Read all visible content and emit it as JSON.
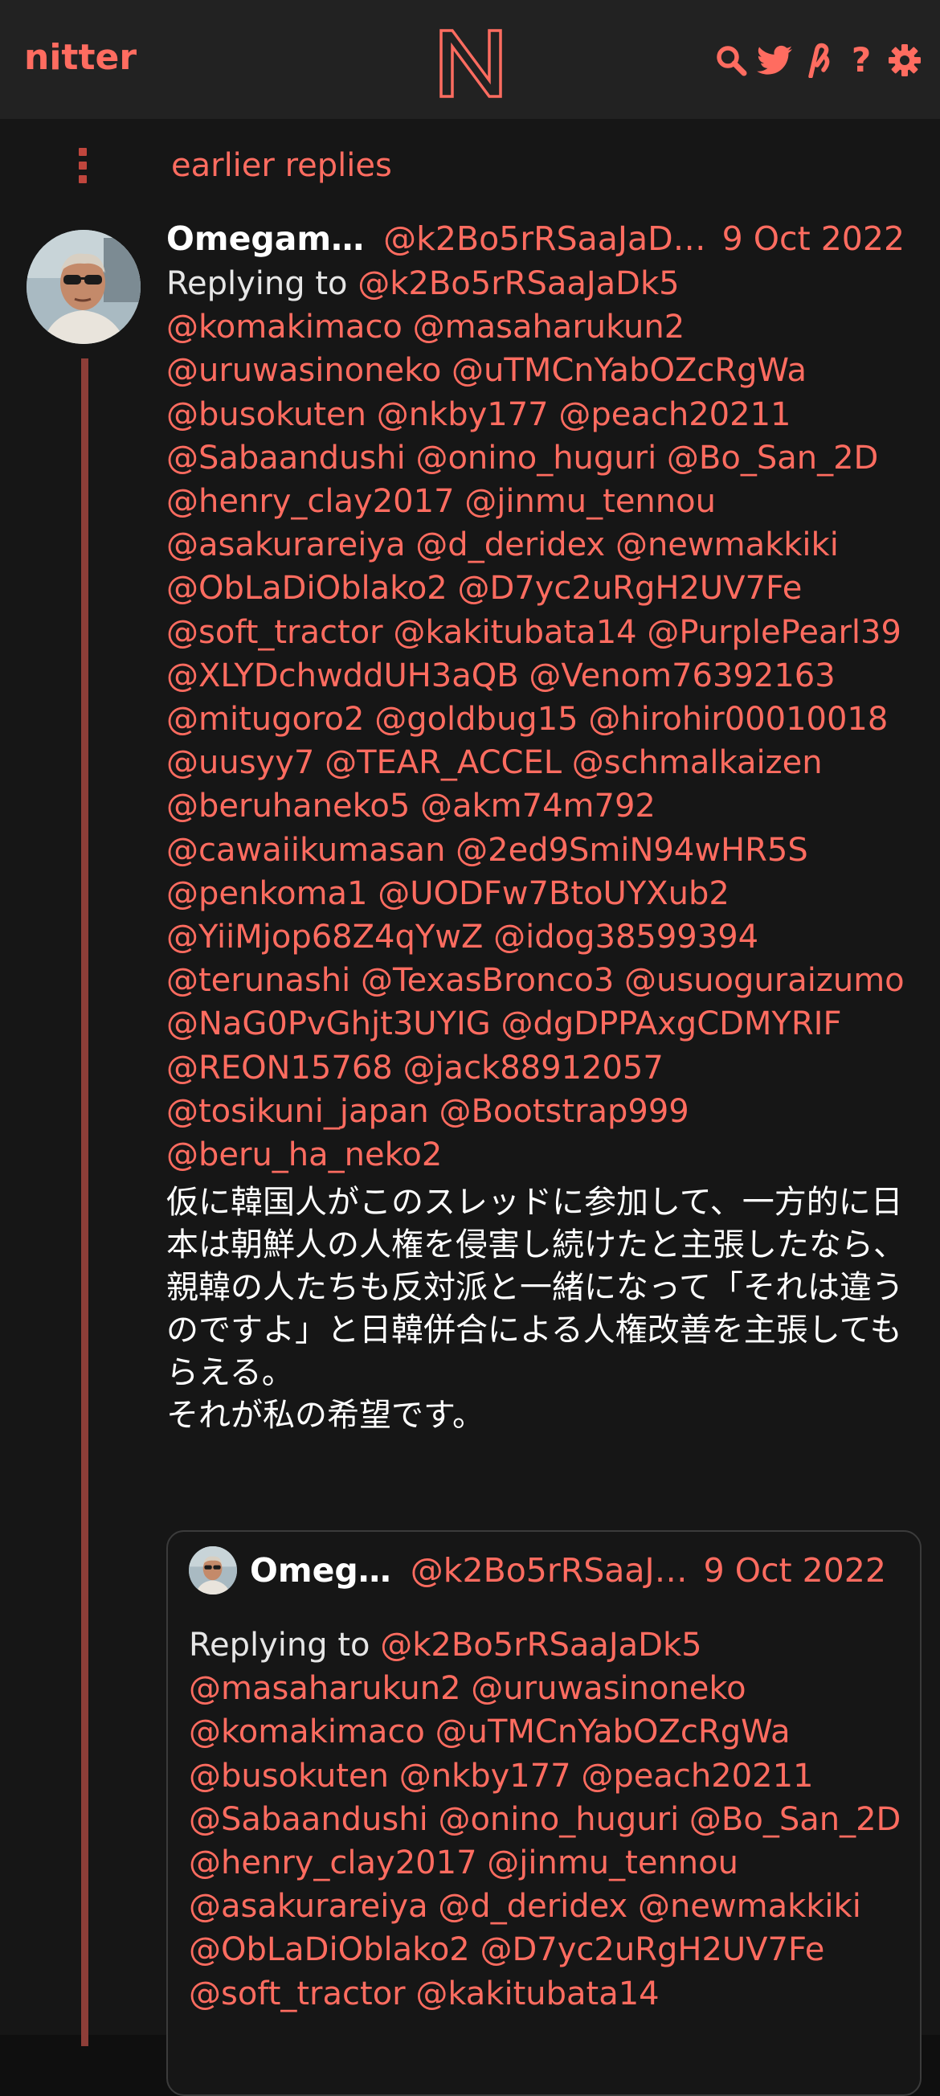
{
  "navbar": {
    "brand": "nitter",
    "logo_letter": "N",
    "icons": [
      "search-icon",
      "twitter-bird-icon",
      "rss-icon",
      "help-icon",
      "settings-gear-icon"
    ],
    "help_glyph": "?"
  },
  "colors": {
    "accent": "#ff6c60",
    "background": "#161616",
    "navbar_bg": "#222222",
    "thread_line": "#8e3e38"
  },
  "thread": {
    "earlier_replies": "earlier replies"
  },
  "tweet": {
    "fullname": "Omegam…",
    "username": "@k2Bo5rRSaaJaD…",
    "date": "9 Oct 2022",
    "replying_label": "Replying to",
    "mentions": [
      "@k2Bo5rRSaaJaDk5",
      "@komakimaco",
      "@masaharukun2",
      "@uruwasinoneko",
      "@uTMCnYabOZcRgWa",
      "@busokuten",
      "@nkby177",
      "@peach20211",
      "@Sabaandushi",
      "@onino_huguri",
      "@Bo_San_2D",
      "@henry_clay2017",
      "@jinmu_tennou",
      "@asakurareiya",
      "@d_deridex",
      "@newmakkiki",
      "@ObLaDiOblako2",
      "@D7yc2uRgH2UV7Fe",
      "@soft_tractor",
      "@kakitubata14",
      "@PurplePearl39",
      "@XLYDchwddUH3aQB",
      "@Venom76392163",
      "@mitugoro2",
      "@goldbug15",
      "@hirohir00010018",
      "@uusyy7",
      "@TEAR_ACCEL",
      "@schmalkaizen",
      "@beruhaneko5",
      "@akm74m792",
      "@cawaiikumasan",
      "@2ed9SmiN94wHR5S",
      "@penkoma1",
      "@UODFw7BtoUYXub2",
      "@YiiMjop68Z4qYwZ",
      "@idog38599394",
      "@terunashi",
      "@TexasBronco3",
      "@usuoguraizumo",
      "@NaG0PvGhjt3UYIG",
      "@dgDPPAxgCDMYRIF",
      "@REON15768",
      "@jack88912057",
      "@tosikuni_japan",
      "@Bootstrap999",
      "@beru_ha_neko2"
    ],
    "content": "仮に韓国人がこのスレッドに参加して、一方的に日本は朝鮮人の人権を侵害し続けたと主張したなら、親韓の人たちも反対派と一緒になって「それは違うのですよ」と日韓併合による人権改善を主張してもらえる。\nそれが私の希望です。"
  },
  "quote": {
    "fullname": "Omeg…",
    "username": "@k2Bo5rRSaaJ…",
    "date": "9 Oct 2022",
    "replying_label": "Replying to",
    "mentions": [
      "@k2Bo5rRSaaJaDk5",
      "@masaharukun2",
      "@uruwasinoneko",
      "@komakimaco",
      "@uTMCnYabOZcRgWa",
      "@busokuten",
      "@nkby177",
      "@peach20211",
      "@Sabaandushi",
      "@onino_huguri",
      "@Bo_San_2D",
      "@henry_clay2017",
      "@jinmu_tennou",
      "@asakurareiya",
      "@d_deridex",
      "@newmakkiki",
      "@ObLaDiOblako2",
      "@D7yc2uRgH2UV7Fe",
      "@soft_tractor",
      "@kakitubata14"
    ]
  }
}
